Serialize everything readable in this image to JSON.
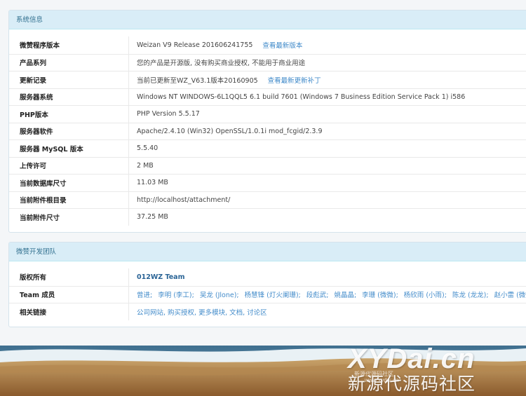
{
  "system_panel": {
    "title": "系统信息",
    "rows": [
      {
        "label": "微赞程序版本",
        "value": "Weizan V9 Release 201606241755",
        "link": "查看最新版本"
      },
      {
        "label": "产品系列",
        "value": "您的产品是开源版, 没有购买商业授权, 不能用于商业用途"
      },
      {
        "label": "更新记录",
        "value": "当前已更新至WZ_V63.1版本20160905",
        "link": "查看最新更新补丁"
      },
      {
        "label": "服务器系统",
        "value": "Windows NT WINDOWS-6L1QQL5 6.1 build 7601 (Windows 7 Business Edition Service Pack 1) i586"
      },
      {
        "label": "PHP版本",
        "value": "PHP Version 5.5.17"
      },
      {
        "label": "服务器软件",
        "value": "Apache/2.4.10 (Win32) OpenSSL/1.0.1i mod_fcgid/2.3.9"
      },
      {
        "label": "服务器 MySQL 版本",
        "value": "5.5.40"
      },
      {
        "label": "上传许可",
        "value": "2 MB"
      },
      {
        "label": "当前数据库尺寸",
        "value": "11.03 MB"
      },
      {
        "label": "当前附件根目录",
        "value": "http://localhost/attachment/"
      },
      {
        "label": "当前附件尺寸",
        "value": "37.25 MB"
      }
    ]
  },
  "team_panel": {
    "title": "微赞开发团队",
    "copyright_label": "版权所有",
    "copyright_value": "012WZ Team",
    "members_label": "Team 成员",
    "members": [
      "曾进;",
      "李明 (李工);",
      "吴龙 (Jlone);",
      "杨慧锋 (灯火阑珊);",
      "段彪武;",
      "姚晶晶;",
      "李珊 (微微);",
      "杨欣雨 (小雨);",
      "陈龙 (龙龙);",
      "赵小雷 (微微);"
    ],
    "links_label": "相关链接",
    "links_value": "公司网站, 购买授权, 更多模块, 文档, 讨论区"
  },
  "watermark": {
    "en": "XYDai.cn",
    "cn": "新源代源码社区",
    "small1": "新源代源码社区",
    "small2": "www.xydai.cn"
  }
}
